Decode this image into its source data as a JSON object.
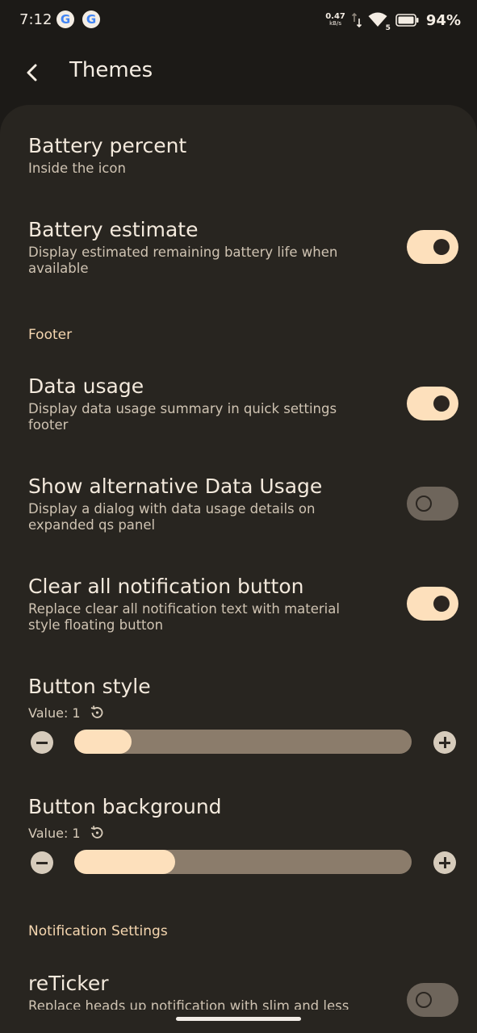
{
  "status_bar": {
    "time": "7:12",
    "net_speed": "0.47",
    "net_unit": "kB/s",
    "wifi_badge": "5",
    "battery": "94%"
  },
  "header": {
    "title": "Themes"
  },
  "settings": {
    "battery_percent": {
      "title": "Battery percent",
      "subtitle": "Inside the icon"
    },
    "battery_estimate": {
      "title": "Battery estimate",
      "subtitle": "Display estimated remaining battery life when available",
      "enabled": true
    },
    "footer_header": "Footer",
    "data_usage": {
      "title": "Data usage",
      "subtitle": "Display data usage summary in quick settings footer",
      "enabled": true
    },
    "alt_data_usage": {
      "title": "Show alternative Data Usage",
      "subtitle": "Display a dialog with data usage details on expanded qs panel",
      "enabled": false
    },
    "clear_all": {
      "title": "Clear all notification button",
      "subtitle": "Replace clear all notification text with material style floating button",
      "enabled": true
    },
    "button_style": {
      "title": "Button style",
      "value_label": "Value: 1",
      "level": 0.17
    },
    "button_background": {
      "title": "Button background",
      "value_label": "Value: 1",
      "level": 0.3
    },
    "notification_header": "Notification Settings",
    "reticker": {
      "title": "reTicker",
      "subtitle": "Replace heads up notification with slim and less",
      "enabled": false
    }
  },
  "colors": {
    "background": "#1c1a17",
    "sheet": "#282520",
    "accent": "#fde0bc",
    "section_header": "#f6d7b0"
  }
}
